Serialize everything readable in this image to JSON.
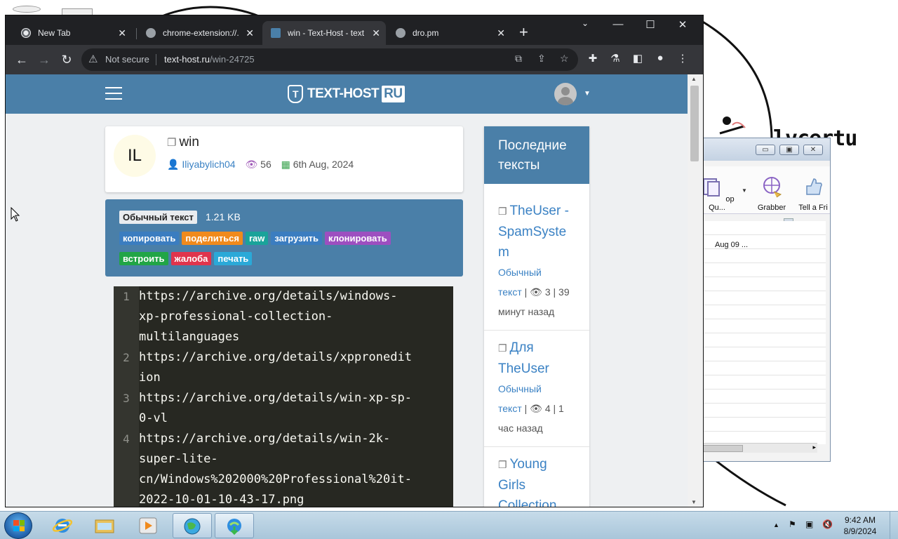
{
  "browser": {
    "tabs": [
      {
        "title": "New Tab"
      },
      {
        "title": "chrome-extension://..."
      },
      {
        "title": "win - Text-Host - text"
      },
      {
        "title": "dro.pm"
      }
    ],
    "address": {
      "security_label": "Not secure",
      "host": "text-host.ru",
      "path": "/win-24725"
    }
  },
  "site": {
    "logo_text": "TEXT-HOST",
    "logo_suffix": "RU",
    "paste": {
      "initials": "IL",
      "title": "win",
      "author": "Iliyabylich04",
      "views": "56",
      "date": "6th Aug, 2024",
      "type_badge": "Обычный текст",
      "size": "1.21 KB"
    },
    "actions_row1": [
      {
        "label": "копировать",
        "color": "#3b7dc0"
      },
      {
        "label": "поделиться",
        "color": "#f08a1c"
      },
      {
        "label": "raw",
        "color": "#1aa39a"
      },
      {
        "label": "загрузить",
        "color": "#3b7dc0"
      },
      {
        "label": "клонировать",
        "color": "#9d4fc0"
      }
    ],
    "actions_row2": [
      {
        "label": "встроить",
        "color": "#21a546"
      },
      {
        "label": "жалоба",
        "color": "#e0344c"
      },
      {
        "label": "печать",
        "color": "#2aa9d8"
      }
    ],
    "code_lines": [
      {
        "num": "1",
        "lines": [
          "https://archive.org/details/windows-",
          "xp-professional-collection-",
          "multilanguages"
        ]
      },
      {
        "num": "2",
        "lines": [
          "https://archive.org/details/xppronedit",
          "ion"
        ]
      },
      {
        "num": "3",
        "lines": [
          "https://archive.org/details/win-xp-sp-",
          "0-vl"
        ]
      },
      {
        "num": "4",
        "lines": [
          "https://archive.org/details/win-2k-",
          "super-lite-",
          "cn/Windows%202000%20Professional%20it-",
          "2022-10-01-10-43-17.png"
        ]
      }
    ],
    "sidebar": {
      "heading_line1": "Последние",
      "heading_line2": "тексты",
      "items": [
        {
          "title_lines": [
            "TheUser -",
            "SpamSyste",
            "m"
          ],
          "type1": "Обычный",
          "type2": "текст",
          "stats": "| 👁 3 | 39",
          "age": "минут назад"
        },
        {
          "title_lines": [
            "Для",
            "TheUser"
          ],
          "type1": "Обычный",
          "type2": "текст",
          "stats": "| 👁 4 | 1",
          "age": "час назад"
        },
        {
          "title_lines": [
            "Young",
            "Girls",
            "Collection"
          ],
          "type1": "",
          "type2": "",
          "stats": "",
          "age": ""
        }
      ]
    }
  },
  "bg_app": {
    "ribbon": [
      {
        "label": "op Qu..."
      },
      {
        "label": "Grabber"
      },
      {
        "label": "Tell a Fri"
      }
    ],
    "cell": "Aug 09 ..."
  },
  "desktop_text": "lvcertu",
  "taskbar": {
    "time": "9:42 AM",
    "date": "8/9/2024"
  }
}
